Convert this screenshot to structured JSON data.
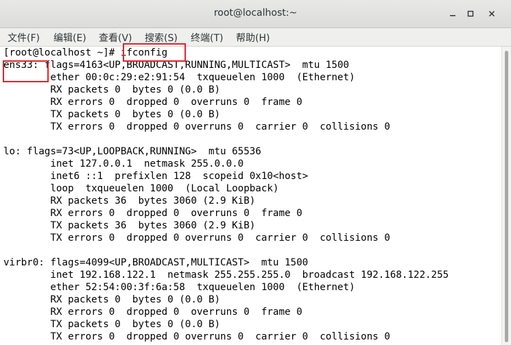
{
  "window": {
    "title": "root@localhost:~"
  },
  "menubar": {
    "items": [
      "文件(F)",
      "编辑(E)",
      "查看(V)",
      "搜索(S)",
      "终端(T)",
      "帮助(H)"
    ]
  },
  "terminal": {
    "lines": [
      "[root@localhost ~]# ifconfig",
      "ens33: flags=4163<UP,BROADCAST,RUNNING,MULTICAST>  mtu 1500",
      "        ether 00:0c:29:e2:91:54  txqueuelen 1000  (Ethernet)",
      "        RX packets 0  bytes 0 (0.0 B)",
      "        RX errors 0  dropped 0  overruns 0  frame 0",
      "        TX packets 0  bytes 0 (0.0 B)",
      "        TX errors 0  dropped 0 overruns 0  carrier 0  collisions 0",
      "",
      "lo: flags=73<UP,LOOPBACK,RUNNING>  mtu 65536",
      "        inet 127.0.0.1  netmask 255.0.0.0",
      "        inet6 ::1  prefixlen 128  scopeid 0x10<host>",
      "        loop  txqueuelen 1000  (Local Loopback)",
      "        RX packets 36  bytes 3060 (2.9 KiB)",
      "        RX errors 0  dropped 0  overruns 0  frame 0",
      "        TX packets 36  bytes 3060 (2.9 KiB)",
      "        TX errors 0  dropped 0 overruns 0  carrier 0  collisions 0",
      "",
      "virbr0: flags=4099<UP,BROADCAST,MULTICAST>  mtu 1500",
      "        inet 192.168.122.1  netmask 255.255.255.0  broadcast 192.168.122.255",
      "        ether 52:54:00:3f:6a:58  txqueuelen 1000  (Ethernet)",
      "        RX packets 0  bytes 0 (0.0 B)",
      "        RX errors 0  dropped 0  overruns 0  frame 0",
      "        TX packets 0  bytes 0 (0.0 B)",
      "        TX errors 0  dropped 0 overruns 0  carrier 0  collisions 0"
    ]
  },
  "colors": {
    "highlight": "#e8202a",
    "text": "#000000",
    "background": "#ffffff"
  }
}
